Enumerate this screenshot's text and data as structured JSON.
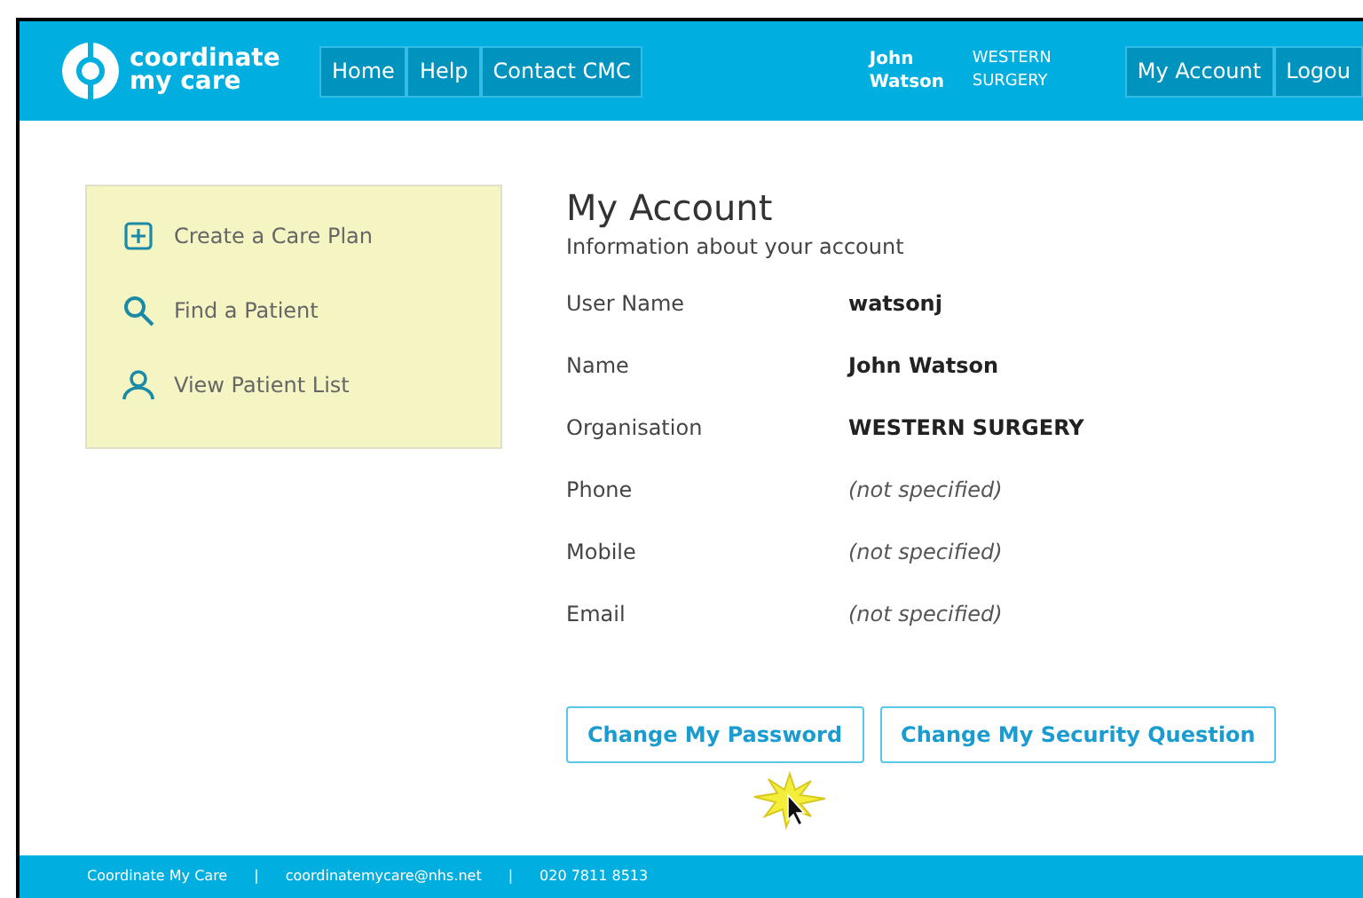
{
  "header": {
    "logo_text": [
      "coordinate",
      "my care"
    ],
    "nav": [
      {
        "label": "Home"
      },
      {
        "label": "Help"
      },
      {
        "label": "Contact CMC"
      }
    ],
    "user_name": [
      "John",
      "Watson"
    ],
    "organisation": [
      "WESTERN",
      "SURGERY"
    ],
    "account_nav": [
      {
        "label": "My Account"
      },
      {
        "label": "Logou"
      }
    ]
  },
  "sidebar": {
    "items": [
      {
        "kind": "plus",
        "label": "Create a Care Plan"
      },
      {
        "kind": "search",
        "label": "Find a Patient"
      },
      {
        "kind": "person",
        "label": "View Patient List"
      }
    ]
  },
  "account": {
    "title": "My Account",
    "subtitle": "Information about your account",
    "fields": [
      {
        "label": "User Name",
        "value": "watsonj",
        "specified": true
      },
      {
        "label": "Name",
        "value": "John Watson",
        "specified": true
      },
      {
        "label": "Organisation",
        "value": "WESTERN SURGERY",
        "specified": true
      },
      {
        "label": "Phone",
        "value": "(not specified)",
        "specified": false
      },
      {
        "label": "Mobile",
        "value": "(not specified)",
        "specified": false
      },
      {
        "label": "Email",
        "value": "(not specified)",
        "specified": false
      }
    ],
    "buttons": [
      {
        "label": "Change My Password"
      },
      {
        "label": "Change My Security Question"
      }
    ]
  },
  "footer": [
    "Coordinate My Care",
    "|",
    "coordinatemycare@nhs.net",
    "|",
    "020 7811 8513"
  ]
}
